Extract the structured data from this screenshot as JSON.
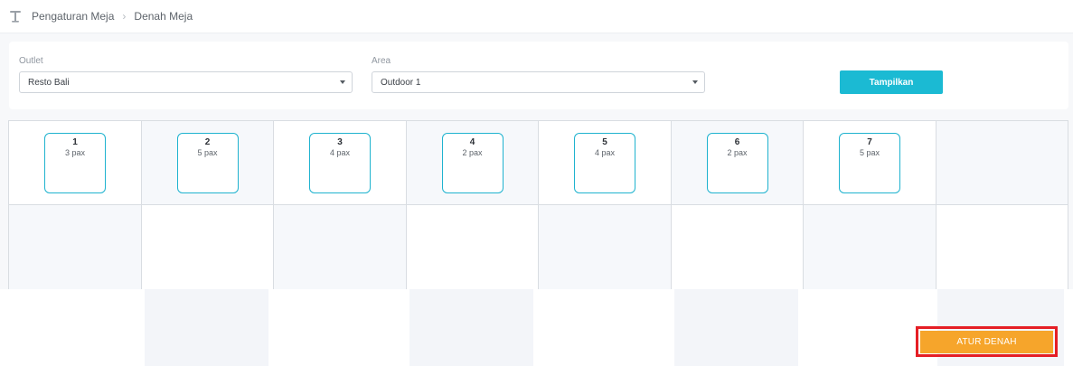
{
  "breadcrumb": {
    "icon": "table-icon",
    "items": [
      "Pengaturan Meja",
      "Denah Meja"
    ]
  },
  "filters": {
    "outlet_label": "Outlet",
    "outlet_value": "Resto Bali",
    "area_label": "Area",
    "area_value": "Outdoor 1",
    "show_button": "Tampilkan"
  },
  "tables": [
    {
      "number": "1",
      "pax": "3 pax"
    },
    {
      "number": "2",
      "pax": "5 pax"
    },
    {
      "number": "3",
      "pax": "4 pax"
    },
    {
      "number": "4",
      "pax": "2 pax"
    },
    {
      "number": "5",
      "pax": "4 pax"
    },
    {
      "number": "6",
      "pax": "2 pax"
    },
    {
      "number": "7",
      "pax": "5 pax"
    }
  ],
  "actions": {
    "arrange_button": "ATUR DENAH"
  },
  "colors": {
    "accent": "#1bbad3",
    "table_border": "#1fb3cf",
    "arrange_button": "#f6a52b",
    "highlight": "#e51e25"
  }
}
